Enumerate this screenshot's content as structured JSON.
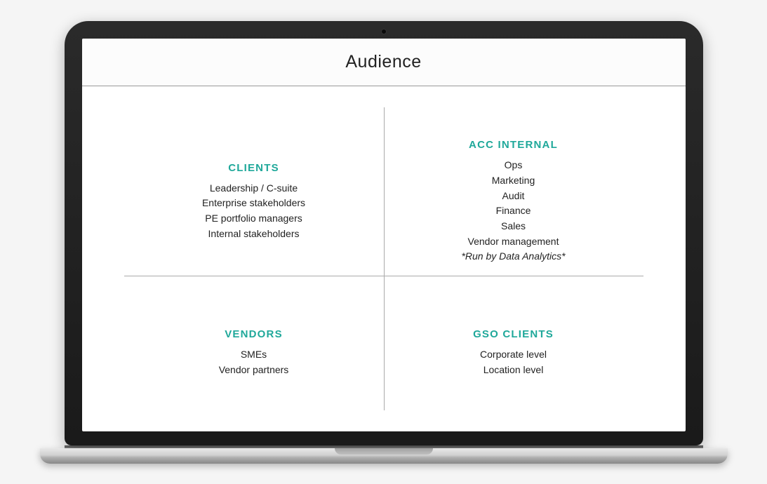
{
  "title": "Audience",
  "quadrants": [
    {
      "title": "CLIENTS",
      "items": [
        "Leadership / C-suite",
        "Enterprise stakeholders",
        "PE portfolio managers",
        "Internal stakeholders"
      ],
      "note": null
    },
    {
      "title": "ACC INTERNAL",
      "items": [
        "Ops",
        "Marketing",
        "Audit",
        "Finance",
        "Sales",
        "Vendor management"
      ],
      "note": "*Run by Data Analytics*"
    },
    {
      "title": "VENDORS",
      "items": [
        "SMEs",
        "Vendor partners"
      ],
      "note": null
    },
    {
      "title": "GSO CLIENTS",
      "items": [
        "Corporate level",
        "Location level"
      ],
      "note": null
    }
  ]
}
